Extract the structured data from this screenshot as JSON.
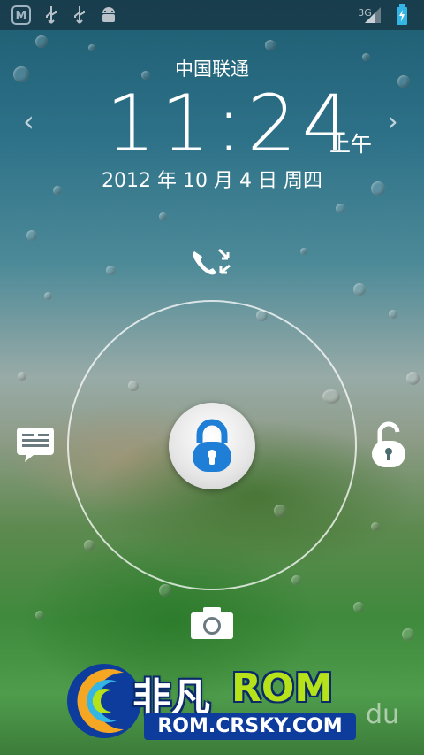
{
  "status_bar": {
    "left_icons": [
      "sync-app-icon",
      "usb-icon",
      "usb-icon",
      "android-debug-icon"
    ],
    "network_label": "3G",
    "right_icons": [
      "signal-icon",
      "battery-charging-icon"
    ]
  },
  "lockscreen": {
    "carrier": "中国联通",
    "time": "11:24",
    "ampm": "上午",
    "date": "2012 年 10 月 4 日 周四",
    "targets": [
      "missed-call-icon",
      "message-icon",
      "unlock-icon",
      "camera-icon"
    ]
  },
  "watermark": {
    "brand_cn": "非凡",
    "brand_en": "ROM",
    "url": "ROM.CRSKY.COM",
    "partial_text": "du"
  },
  "colors": {
    "lock_blue": "#1f7fd6",
    "brand_green": "#b6e21a",
    "brand_navy": "#0e3c9c"
  }
}
